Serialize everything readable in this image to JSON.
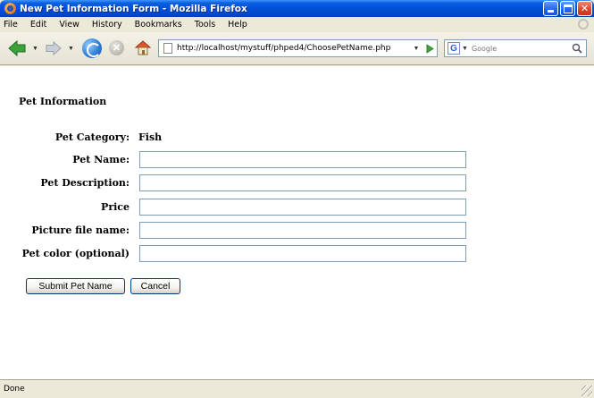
{
  "window": {
    "title": "New Pet Information Form - Mozilla Firefox"
  },
  "menu": {
    "items": [
      "File",
      "Edit",
      "View",
      "History",
      "Bookmarks",
      "Tools",
      "Help"
    ]
  },
  "navbar": {
    "url": "http://localhost/mystuff/phped4/ChoosePetName.php",
    "search_placeholder": "Google"
  },
  "page": {
    "title": "Pet Information",
    "fields": {
      "category_label": "Pet Category:",
      "category_value": "Fish",
      "name_label": "Pet Name:",
      "description_label": "Pet Description:",
      "price_label": "Price",
      "picture_label": "Picture file name:",
      "color_label": "Pet color (optional)"
    },
    "buttons": {
      "submit": "Submit Pet Name",
      "cancel": "Cancel"
    }
  },
  "status": {
    "text": "Done"
  }
}
